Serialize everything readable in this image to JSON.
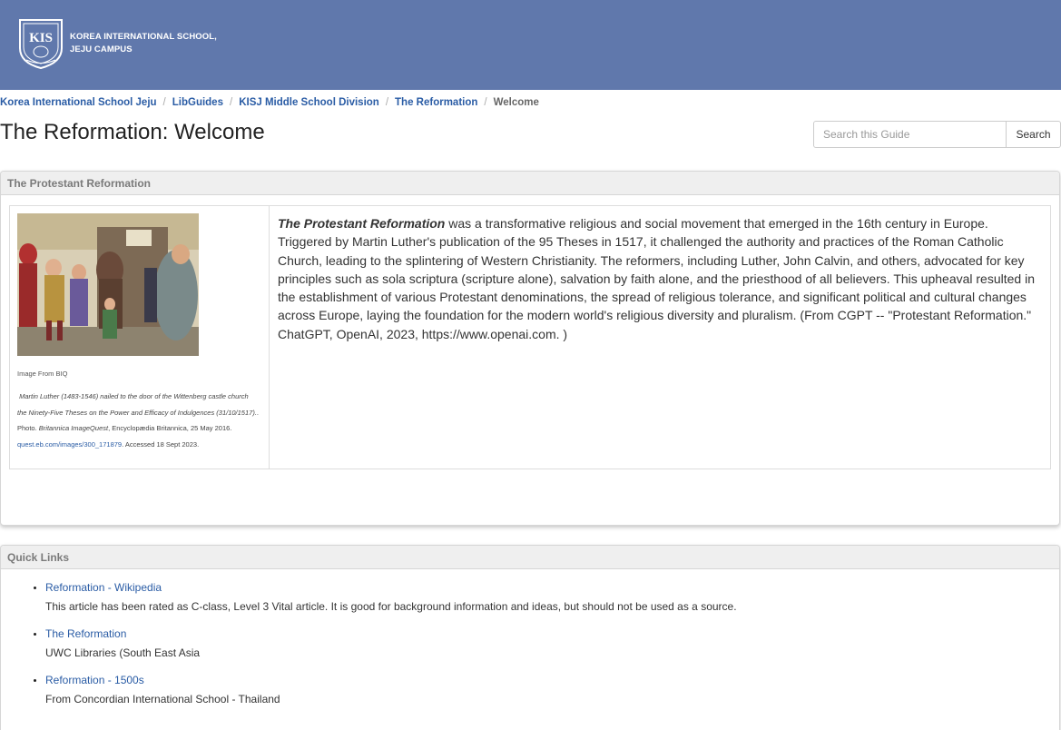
{
  "header": {
    "logo_line1": "KOREA INTERNATIONAL SCHOOL,",
    "logo_line2": "JEJU CAMPUS",
    "crest_text": "KIS",
    "brand_color": "#6078ac"
  },
  "breadcrumb": {
    "items": [
      "Korea International School Jeju",
      "LibGuides",
      "KISJ Middle School Division",
      "The Reformation"
    ],
    "current": "Welcome"
  },
  "page_title": "The Reformation: Welcome",
  "search": {
    "placeholder": "Search this Guide",
    "button_label": "Search"
  },
  "panel1": {
    "heading": "The Protestant Reformation",
    "image_source": "Image From BIQ",
    "caption": {
      "title": "Martin Luther (1483-1546) nailed to the door of the Wittenberg castle church the Ninety-Five Theses on the Power and Efficacy of Indulgences (31/10/1517).",
      "photo": ". Photo. ",
      "publisher_italic": "Britannica ImageQuest",
      "publisher_rest": ", Encyclopædia Britannica, 25 May 2016. ",
      "link": "quest.eb.com/images/300_171879",
      "accessed": ". Accessed 18 Sept 2023."
    },
    "body_bold": "The Protestant Reformation",
    "body_text": " was a transformative religious and social movement that emerged in the 16th century in Europe. Triggered by Martin Luther's publication of the 95 Theses in 1517, it challenged the authority and practices of the Roman Catholic Church, leading to the splintering of Western Christianity. The reformers, including Luther, John Calvin, and others, advocated for key principles such as sola scriptura (scripture alone), salvation by faith alone, and the priesthood of all believers. This upheaval resulted in the establishment of various Protestant denominations, the spread of religious tolerance, and significant political and cultural changes across Europe, laying the foundation for the modern world's religious diversity and pluralism. (From CGPT -- \"Protestant Reformation.\" ChatGPT, OpenAI, 2023, https://www.openai.com. )"
  },
  "panel2": {
    "heading": "Quick Links",
    "links": [
      {
        "label": "Reformation - Wikipedia",
        "desc": "This article has been rated as C-class, Level 3 Vital article. It is good for background information and ideas, but should not be used as a source."
      },
      {
        "label": "The Reformation",
        "desc": "UWC Libraries (South East Asia"
      },
      {
        "label": "Reformation - 1500s",
        "desc": "From Concordian International School - Thailand"
      }
    ]
  }
}
